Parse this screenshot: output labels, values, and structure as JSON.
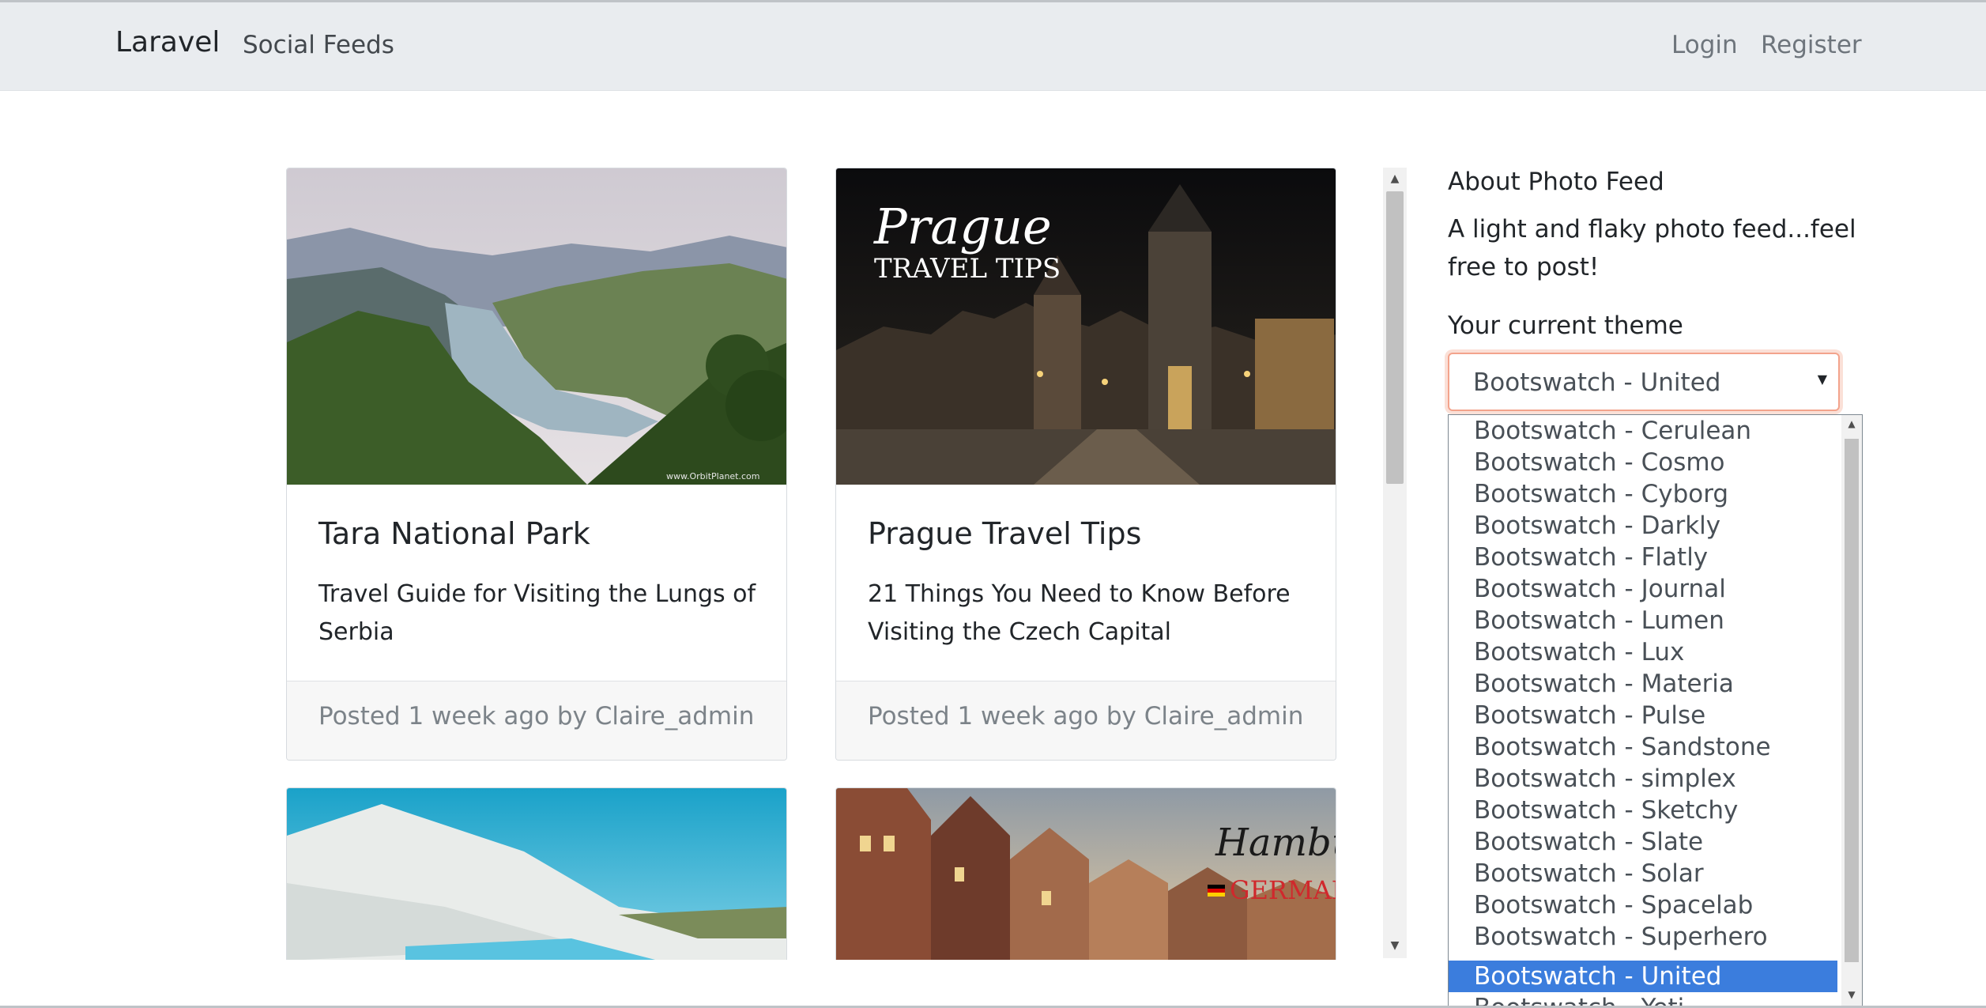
{
  "navbar": {
    "brand": "Laravel",
    "feeds_link": "Social Feeds",
    "login": "Login",
    "register": "Register"
  },
  "posts": [
    {
      "title": "Tara National Park",
      "description": "Travel Guide for Visiting the Lungs of Serbia",
      "footer": "Posted 1 week ago by Claire_admin",
      "image_watermark": "www.OrbitPlanet.com"
    },
    {
      "title": "Prague Travel Tips",
      "description": "21 Things You Need to Know Before Visiting the Czech Capital",
      "footer": "Posted 1 week ago by Claire_admin",
      "image_caption_1": "Prague",
      "image_caption_2": "TRAVEL TIPS"
    },
    {
      "image_alt": "Pamukkale travertine terraces"
    },
    {
      "image_caption_1": "Hamburg",
      "image_caption_2": "GERMANY"
    }
  ],
  "sidebar": {
    "title": "About Photo Feed",
    "description": "A light and flaky photo feed...feel free to post!",
    "theme_label": "Your current theme",
    "theme_selected": "Bootswatch - United",
    "theme_options": [
      "Bootswatch - Cerulean",
      "Bootswatch - Cosmo",
      "Bootswatch - Cyborg",
      "Bootswatch - Darkly",
      "Bootswatch - Flatly",
      "Bootswatch - Journal",
      "Bootswatch - Lumen",
      "Bootswatch - Lux",
      "Bootswatch - Materia",
      "Bootswatch - Pulse",
      "Bootswatch - Sandstone",
      "Bootswatch - simplex",
      "Bootswatch - Sketchy",
      "Bootswatch - Slate",
      "Bootswatch - Solar",
      "Bootswatch - Spacelab",
      "Bootswatch - Superhero",
      "Bootswatch - United",
      "Bootswatch - Yeti"
    ]
  },
  "colors": {
    "navbar_bg": "#e9ecef",
    "selected_option": "#3b7ddd",
    "select_focus_border": "#f3a38c"
  }
}
